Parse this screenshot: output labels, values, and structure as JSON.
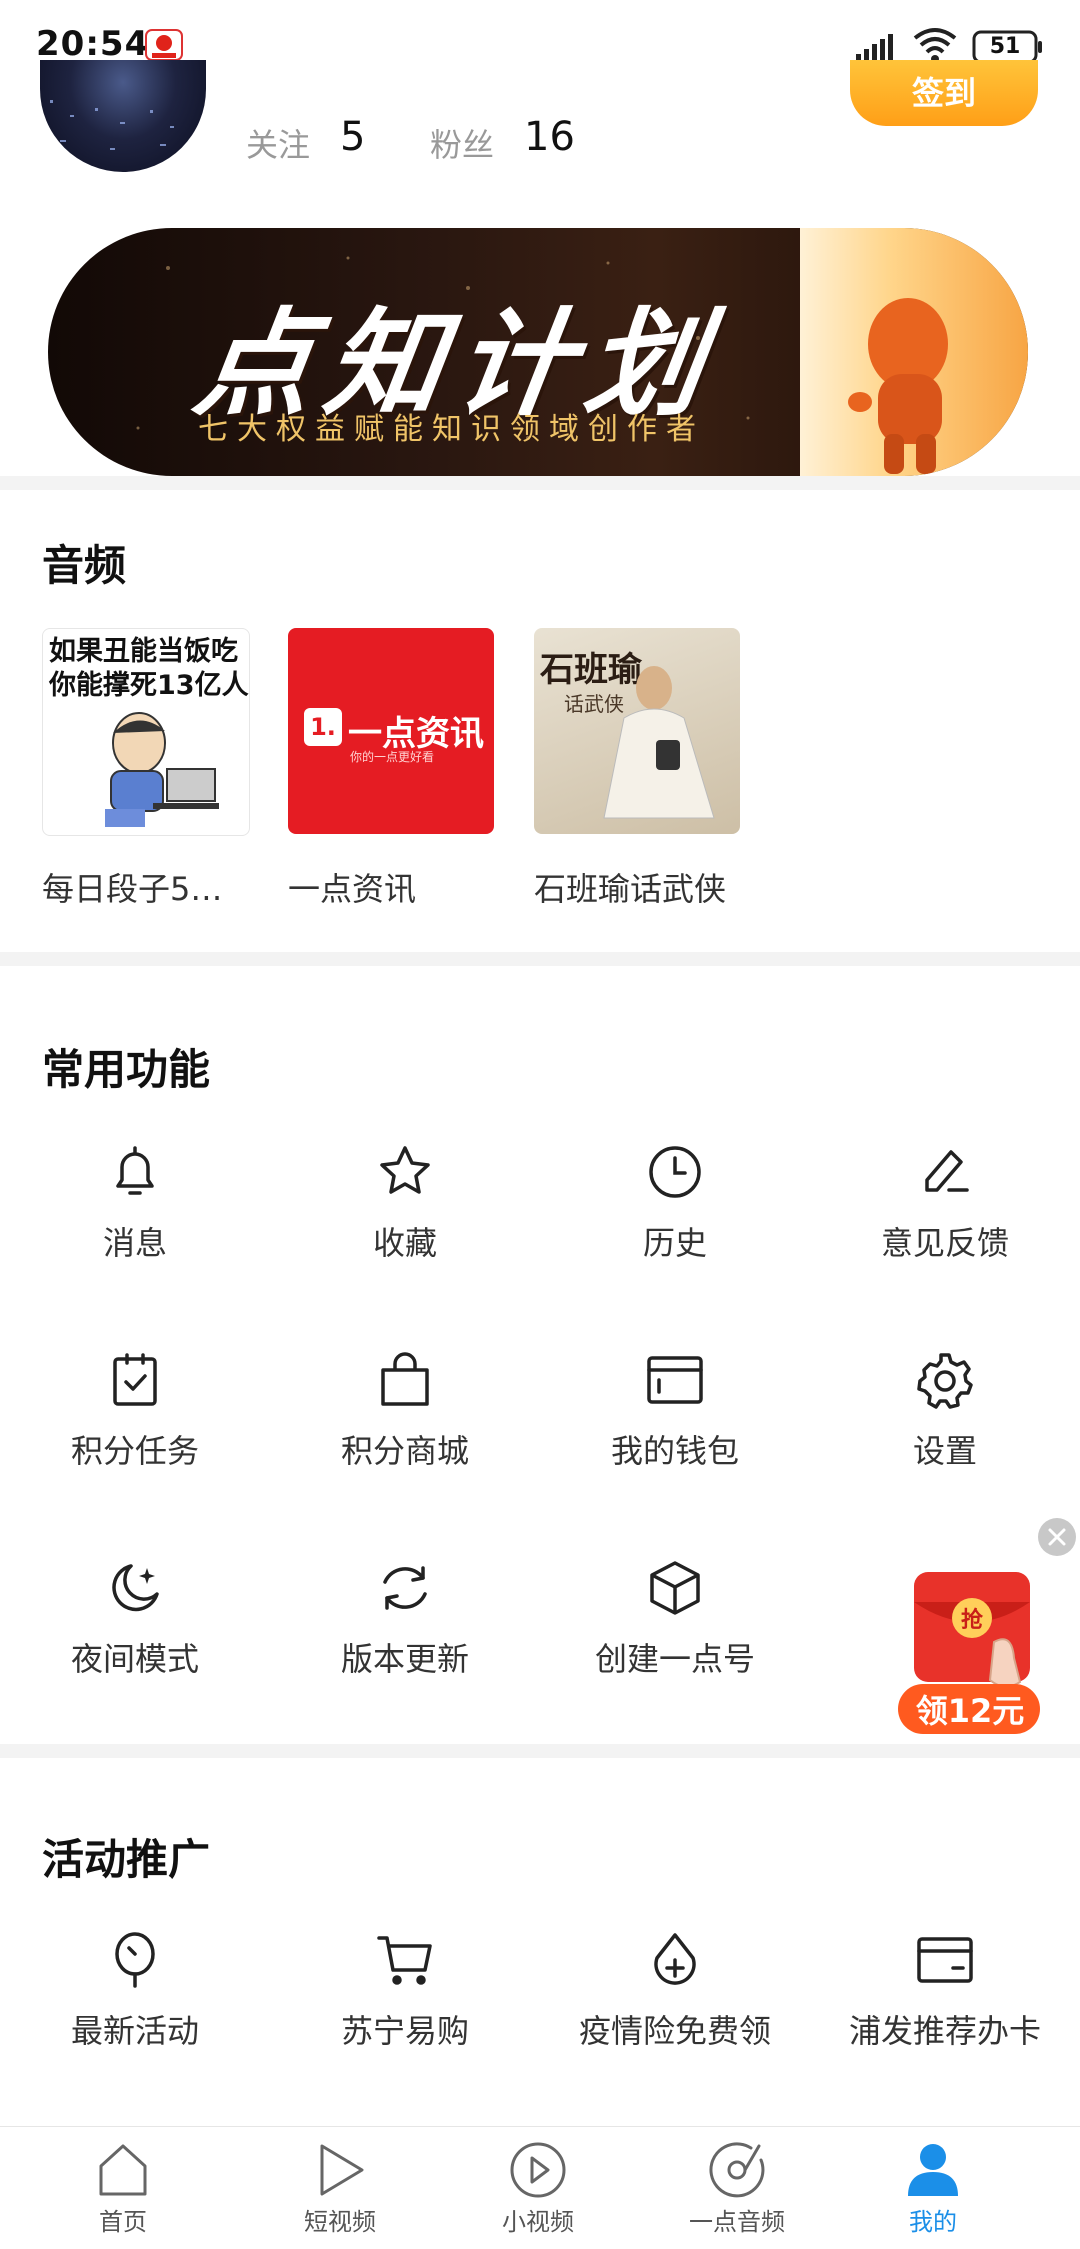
{
  "status_bar": {
    "time": "20:54",
    "battery": "51"
  },
  "profile": {
    "follow_label": "关注",
    "follow_count": "5",
    "fans_label": "粉丝",
    "fans_count": "16",
    "checkin_label": "签到"
  },
  "banner": {
    "title": "点知计划",
    "subtitle": "七大权益赋能知识领域创作者"
  },
  "audio": {
    "title": "音频",
    "items": [
      {
        "label": "每日段子5…",
        "thumb_text_line1": "如果丑能当饭吃",
        "thumb_text_line2": "你能撑死13亿人"
      },
      {
        "label": "一点资讯",
        "thumb_text": "一点资讯",
        "thumb_tagline": "你的一点更好看"
      },
      {
        "label": "石班瑜话武侠",
        "thumb_text": "石班瑜",
        "thumb_sub": "话武侠"
      }
    ]
  },
  "functions": {
    "title": "常用功能",
    "items": [
      {
        "label": "消息",
        "icon": "bell-icon"
      },
      {
        "label": "收藏",
        "icon": "star-icon"
      },
      {
        "label": "历史",
        "icon": "clock-icon"
      },
      {
        "label": "意见反馈",
        "icon": "pen-icon"
      },
      {
        "label": "积分任务",
        "icon": "clipboard-check-icon"
      },
      {
        "label": "积分商城",
        "icon": "shopping-bag-icon"
      },
      {
        "label": "我的钱包",
        "icon": "wallet-icon"
      },
      {
        "label": "设置",
        "icon": "gear-icon"
      },
      {
        "label": "夜间模式",
        "icon": "moon-icon"
      },
      {
        "label": "版本更新",
        "icon": "refresh-icon"
      },
      {
        "label": "创建一点号",
        "icon": "cube-icon"
      }
    ]
  },
  "promo": {
    "title": "活动推广",
    "items": [
      {
        "label": "最新活动",
        "icon": "balloon-icon"
      },
      {
        "label": "苏宁易购",
        "icon": "cart-icon"
      },
      {
        "label": "疫情险免费领",
        "icon": "drop-plus-icon"
      },
      {
        "label": "浦发推荐办卡",
        "icon": "card-icon"
      }
    ]
  },
  "floating": {
    "envelope_char": "抢",
    "envelope_text": "领12元"
  },
  "bottom_nav": {
    "items": [
      {
        "label": "首页",
        "icon": "home-icon",
        "active": false
      },
      {
        "label": "短视频",
        "icon": "play-icon",
        "active": false
      },
      {
        "label": "小视频",
        "icon": "play-circle-icon",
        "active": false
      },
      {
        "label": "一点音频",
        "icon": "music-disc-icon",
        "active": false
      },
      {
        "label": "我的",
        "icon": "user-icon",
        "active": true
      }
    ],
    "active_color": "#1b8fe8"
  }
}
